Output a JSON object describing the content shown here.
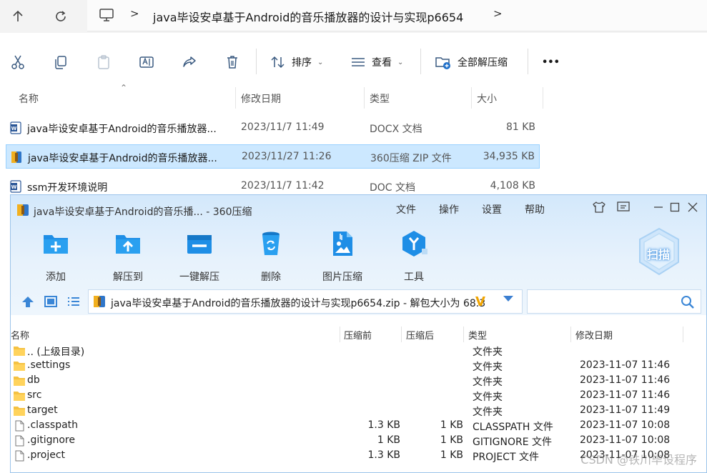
{
  "explorer": {
    "breadcrumb_sep_1": ">",
    "breadcrumb_folder": "java毕设安卓基于Android的音乐播放器的设计与实现p6654",
    "breadcrumb_sep_2": ">",
    "toolbar": {
      "sort_label": "排序",
      "view_label": "查看",
      "extract_all_label": "全部解压缩",
      "more_label": "•••"
    },
    "columns": {
      "name": "名称",
      "modified": "修改日期",
      "type": "类型",
      "size": "大小"
    },
    "files": [
      {
        "name": "java毕设安卓基于Android的音乐播放器...",
        "modified": "2023/11/7 11:49",
        "type": "DOCX 文档",
        "size": "81 KB",
        "icon": "word-doc-icon",
        "selected": false
      },
      {
        "name": "java毕设安卓基于Android的音乐播放器...",
        "modified": "2023/11/27 11:26",
        "type": "360压缩 ZIP 文件",
        "size": "34,935 KB",
        "icon": "zip-archive-icon",
        "selected": true
      },
      {
        "name": "ssm开发环境说明",
        "modified": "2023/11/7 11:42",
        "type": "DOC 文档",
        "size": "4,108 KB",
        "icon": "word-doc-icon",
        "selected": false
      }
    ]
  },
  "zip_window": {
    "title": "java毕设安卓基于Android的音乐播... - 360压缩",
    "menu": [
      "文件",
      "操作",
      "设置",
      "帮助"
    ],
    "tools": [
      {
        "label": "添加",
        "icon": "add-icon"
      },
      {
        "label": "解压到",
        "icon": "extract-to-icon"
      },
      {
        "label": "一键解压",
        "icon": "one-click-extract-icon"
      },
      {
        "label": "删除",
        "icon": "delete-icon"
      },
      {
        "label": "图片压缩",
        "icon": "image-compress-icon"
      },
      {
        "label": "工具",
        "icon": "tools-icon"
      }
    ],
    "scan_label": "扫描",
    "path": "java毕设安卓基于Android的音乐播放器的设计与实现p6654.zip - 解包大小为 68.3",
    "columns": {
      "name": "名称",
      "compressed": "压缩前",
      "after": "压缩后",
      "type": "类型",
      "modified": "修改日期"
    },
    "entries": [
      {
        "name": ".. (上级目录)",
        "compressed": "",
        "after": "",
        "type": "文件夹",
        "modified": "",
        "kind": "folder"
      },
      {
        "name": ".settings",
        "compressed": "",
        "after": "",
        "type": "文件夹",
        "modified": "2023-11-07 11:46",
        "kind": "folder"
      },
      {
        "name": "db",
        "compressed": "",
        "after": "",
        "type": "文件夹",
        "modified": "2023-11-07 11:46",
        "kind": "folder"
      },
      {
        "name": "src",
        "compressed": "",
        "after": "",
        "type": "文件夹",
        "modified": "2023-11-07 11:46",
        "kind": "folder"
      },
      {
        "name": "target",
        "compressed": "",
        "after": "",
        "type": "文件夹",
        "modified": "2023-11-07 11:49",
        "kind": "folder"
      },
      {
        "name": ".classpath",
        "compressed": "1.3 KB",
        "after": "1 KB",
        "type": "CLASSPATH 文件",
        "modified": "2023-11-07 10:08",
        "kind": "file"
      },
      {
        "name": ".gitignore",
        "compressed": "1 KB",
        "after": "1 KB",
        "type": "GITIGNORE 文件",
        "modified": "2023-11-07 10:08",
        "kind": "file"
      },
      {
        "name": ".project",
        "compressed": "1.3 KB",
        "after": "1 KB",
        "type": "PROJECT 文件",
        "modified": "2023-11-07 10:08",
        "kind": "file"
      }
    ]
  },
  "watermark": "CSDN @铁川毕设程序",
  "colors": {
    "selection_bg": "#cce8ff",
    "zip_accent": "#1e8ee6",
    "zip_header_bg": "#d3e8fb"
  }
}
